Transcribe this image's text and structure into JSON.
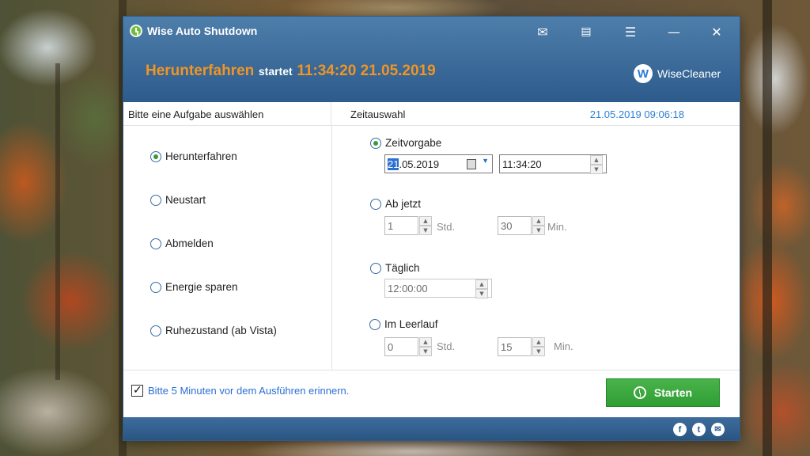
{
  "window": {
    "title": "Wise Auto Shutdown",
    "controls": {
      "mail": "✉",
      "feedback": "▤",
      "menu": "☰",
      "minimize": "—",
      "close": "✕"
    }
  },
  "header": {
    "action": "Herunterfahren",
    "starts": "startet",
    "datetime": "11:34:20 21.05.2019",
    "brand_logo": "W",
    "brand": "WiseCleaner"
  },
  "tasks": {
    "heading": "Bitte eine Aufgabe auswählen",
    "items": [
      {
        "label": "Herunterfahren",
        "selected": true
      },
      {
        "label": "Neustart",
        "selected": false
      },
      {
        "label": "Abmelden",
        "selected": false
      },
      {
        "label": "Energie sparen",
        "selected": false
      },
      {
        "label": "Ruhezustand (ab Vista)",
        "selected": false
      }
    ]
  },
  "time": {
    "heading": "Zeitauswahl",
    "current": "21.05.2019 09:06:18",
    "fixed": {
      "label": "Zeitvorgabe",
      "selected": true,
      "date_selected": "21",
      "date_rest": ".05.2019",
      "time": "11:34:20"
    },
    "from_now": {
      "label": "Ab jetzt",
      "selected": false,
      "hours": "1",
      "hours_unit": "Std.",
      "minutes": "30",
      "minutes_unit": "Min."
    },
    "daily": {
      "label": "Täglich",
      "selected": false,
      "time": "12:00:00"
    },
    "idle": {
      "label": "Im Leerlauf",
      "selected": false,
      "hours": "0",
      "hours_unit": "Std.",
      "minutes": "15",
      "minutes_unit": "Min."
    }
  },
  "footer": {
    "reminder": "Bitte 5 Minuten vor dem Ausführen erinnern.",
    "reminder_checked": true,
    "start": "Starten",
    "social": {
      "facebook": "f",
      "twitter": "t",
      "mail": "✉"
    }
  },
  "colors": {
    "accent_orange": "#f09524",
    "header_blue": "#2d5b8c",
    "link_blue": "#2b7fd3",
    "start_green": "#2e9e34"
  }
}
